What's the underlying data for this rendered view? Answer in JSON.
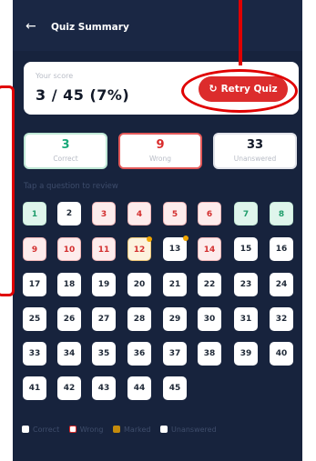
{
  "header": {
    "title": "Quiz Summary",
    "back_icon": "arrow-left-icon"
  },
  "score": {
    "label": "Your score",
    "value": "3 / 45  (7%)"
  },
  "retry_button": {
    "label": "Retry Quiz",
    "icon": "refresh-icon"
  },
  "stats": {
    "correct": {
      "value": "3",
      "label": "Correct"
    },
    "wrong": {
      "value": "9",
      "label": "Wrong"
    },
    "unanswered": {
      "value": "33",
      "label": "Unanswered"
    }
  },
  "hint": "Tap a question to review",
  "questions": [
    {
      "n": "1",
      "status": "correct"
    },
    {
      "n": "2",
      "status": "unans"
    },
    {
      "n": "3",
      "status": "wrong"
    },
    {
      "n": "4",
      "status": "wrong"
    },
    {
      "n": "5",
      "status": "wrong"
    },
    {
      "n": "6",
      "status": "wrong"
    },
    {
      "n": "7",
      "status": "correct"
    },
    {
      "n": "8",
      "status": "correct"
    },
    {
      "n": "9",
      "status": "wrong"
    },
    {
      "n": "10",
      "status": "wrong"
    },
    {
      "n": "11",
      "status": "wrong"
    },
    {
      "n": "12",
      "status": "marked"
    },
    {
      "n": "13",
      "status": "marked-unans"
    },
    {
      "n": "14",
      "status": "wrong"
    },
    {
      "n": "15",
      "status": "unans"
    },
    {
      "n": "16",
      "status": "unans"
    },
    {
      "n": "17",
      "status": "unans"
    },
    {
      "n": "18",
      "status": "unans"
    },
    {
      "n": "19",
      "status": "unans"
    },
    {
      "n": "20",
      "status": "unans"
    },
    {
      "n": "21",
      "status": "unans"
    },
    {
      "n": "22",
      "status": "unans"
    },
    {
      "n": "23",
      "status": "unans"
    },
    {
      "n": "24",
      "status": "unans"
    },
    {
      "n": "25",
      "status": "unans"
    },
    {
      "n": "26",
      "status": "unans"
    },
    {
      "n": "27",
      "status": "unans"
    },
    {
      "n": "28",
      "status": "unans"
    },
    {
      "n": "29",
      "status": "unans"
    },
    {
      "n": "30",
      "status": "unans"
    },
    {
      "n": "31",
      "status": "unans"
    },
    {
      "n": "32",
      "status": "unans"
    },
    {
      "n": "33",
      "status": "unans"
    },
    {
      "n": "34",
      "status": "unans"
    },
    {
      "n": "35",
      "status": "unans"
    },
    {
      "n": "36",
      "status": "unans"
    },
    {
      "n": "37",
      "status": "unans"
    },
    {
      "n": "38",
      "status": "unans"
    },
    {
      "n": "39",
      "status": "unans"
    },
    {
      "n": "40",
      "status": "unans"
    },
    {
      "n": "41",
      "status": "unans"
    },
    {
      "n": "42",
      "status": "unans"
    },
    {
      "n": "43",
      "status": "unans"
    },
    {
      "n": "44",
      "status": "unans"
    },
    {
      "n": "45",
      "status": "unans"
    }
  ],
  "legend": [
    {
      "label": "Correct",
      "key": "correct"
    },
    {
      "label": "Wrong",
      "key": "wrong"
    },
    {
      "label": "Marked",
      "key": "marked"
    },
    {
      "label": "Unanswered",
      "key": "unans"
    }
  ],
  "colors": {
    "panel_bg": "#17233d",
    "accent_red": "#dc2c2c",
    "correct_green": "#1aa97a",
    "marked_amber": "#f0a500",
    "annotation_red": "#e00000"
  }
}
